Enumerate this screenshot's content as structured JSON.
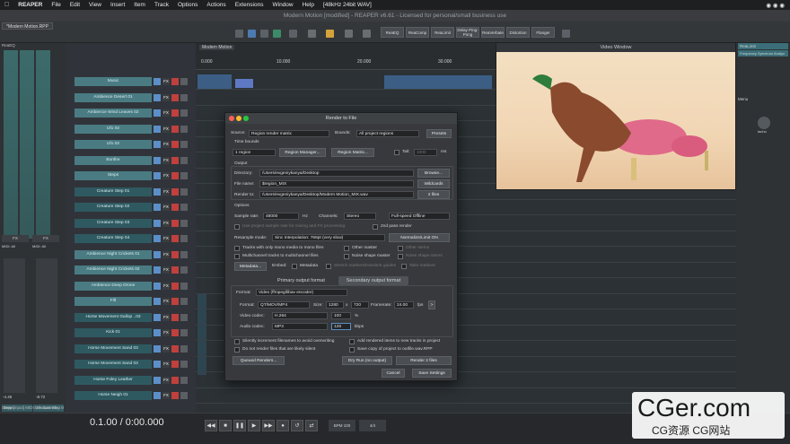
{
  "menubar": {
    "app": "REAPER",
    "items": [
      "File",
      "Edit",
      "View",
      "Insert",
      "Item",
      "Track",
      "Options",
      "Actions",
      "Extensions",
      "Window",
      "Help",
      "[48kHz 24bit WAV]"
    ]
  },
  "titlebar": {
    "title": "Modern Motion [modified] - REAPER v6.61 - Licensed for personal/small business use"
  },
  "toolbar": {
    "buttons": [
      "ReaEQ",
      "ReaComp",
      "ReaLimit",
      "Delay Ping-Pong",
      "ReaVerbate",
      "Distortion",
      "Flanger"
    ]
  },
  "tab": {
    "label": "*Modern Motion.RPP"
  },
  "project_tab": {
    "label": "Modern Motion"
  },
  "left": {
    "meter_label": "ReaEQ",
    "ticks": [
      "-4.45",
      "-8.72"
    ],
    "master": "MASTER",
    "track_name": "Steps",
    "track2_name": "Creature Step 01",
    "fx": [
      "FX",
      "FX"
    ],
    "midi": [
      "MIDI: All",
      "MIDI: All"
    ]
  },
  "tracks": [
    {
      "name": "Music",
      "dark": false
    },
    {
      "name": "Ambience Desert 01",
      "dark": false
    },
    {
      "name": "Ambience Wind Leaves 02",
      "dark": false
    },
    {
      "name": "Ufo 02",
      "dark": false
    },
    {
      "name": "Ufo 02",
      "dark": false
    },
    {
      "name": "Bonfire",
      "dark": false
    },
    {
      "name": "Steps",
      "dark": false
    },
    {
      "name": "Creature Step 01",
      "dark": true
    },
    {
      "name": "Creature Step 02",
      "dark": true
    },
    {
      "name": "Creature Step 03",
      "dark": true
    },
    {
      "name": "Creature Step 04",
      "dark": true
    },
    {
      "name": "Ambience Night Crickets 01",
      "dark": false
    },
    {
      "name": "Ambience Night Crickets 02",
      "dark": false
    },
    {
      "name": "Ambience Deep Drone",
      "dark": false
    },
    {
      "name": "Fill",
      "dark": false
    },
    {
      "name": "Horse Movement Gallop ..03",
      "dark": true
    },
    {
      "name": "Kick 01",
      "dark": true
    },
    {
      "name": "Horse Movement Sand 03",
      "dark": true
    },
    {
      "name": "Horse Movement Sand 03",
      "dark": true
    },
    {
      "name": "Horse Foley Leather",
      "dark": true
    },
    {
      "name": "Horse Neigh 01",
      "dark": true
    }
  ],
  "ruler": {
    "marks": [
      "0.000",
      "10.000",
      "20.000",
      "30.000"
    ]
  },
  "right": {
    "labels": [
      "ReaLimit",
      "Frequency Spectrum Analyz",
      "Menu",
      "tacho"
    ]
  },
  "transport": {
    "status": "Steps [input] MIDI: All channels",
    "time": "0.1.00 / 0:00.000",
    "bpm_label": "BPM",
    "bpm": "100",
    "sig": "4/4"
  },
  "dialog": {
    "title": "Render to File",
    "source_label": "Source:",
    "source": "Region render matrix",
    "bounds_label": "Bounds:",
    "bounds": "All project regions",
    "presets": "Presets",
    "time_bounds": "Time bounds",
    "regions": "1 region",
    "region_manager": "Region Manager...",
    "region_matrix": "Region Matrix...",
    "tail_label": "Tail:",
    "tail": "1000",
    "tail_unit": "ms",
    "output": "Output",
    "directory_label": "Directory:",
    "directory": "/Users/evgeniykanya/Desktop",
    "browse": "Browse...",
    "filename_label": "File name:",
    "filename": "$region_MIX",
    "wildcards": "Wildcards",
    "renderto_label": "Render to:",
    "renderto": "/Users/evgeniykanya/Desktop/Modern Motion_MIX.wav",
    "files": "2 files",
    "options": "Options",
    "samplerate_label": "Sample rate:",
    "samplerate": "48000",
    "hz": "Hz",
    "channels_label": "Channels:",
    "channels": "Stereo",
    "speed": "Full-speed Offline",
    "use_project": "Use project sample rate for mixing and FX processing",
    "second_pass": "2nd pass render",
    "resample_label": "Resample mode:",
    "resample": "Sinc Interpolation: 768pt (very slow)",
    "normalize": "Normalize/Limit ON",
    "chk_mono": "Tracks with only mono media to mono files",
    "chk_multi": "Multichannel tracks to multichannel files",
    "chk_other_master": "Other master",
    "chk_noise_master": "Noise shape master",
    "chk_other_stems": "Other stems",
    "chk_noise_stems": "Noise shape stems",
    "metadata_btn": "Metadata...",
    "embed": "Embed:",
    "chk_metadata": "Metadata",
    "chk_stretch": "Stretch markers/transient guides",
    "chk_take": "Take markers",
    "tab_primary": "Primary output format",
    "tab_secondary": "Secondary output format",
    "format_label": "Format:",
    "format": "Video (ffmpeg/libav encoder)",
    "format2_label": "Format:",
    "format2": "QT/MOV/MP4",
    "size_label": "Size:",
    "width": "1280",
    "x": "x",
    "height": "720",
    "framerate_label": "Framerate:",
    "framerate": "24.00",
    "fps": "fps",
    "videocodec_label": "Video codec:",
    "videocodec": "H.264",
    "vquality": "100",
    "pct": "%",
    "audiocodec_label": "Audio codec:",
    "audiocodec": "MP3",
    "abitrate": "128",
    "kbps": "kbps",
    "chk_silent": "Silently increment filenames to avoid overwriting",
    "chk_dontrender": "Do not render files that are likely silent",
    "chk_addrendered": "Add rendered items to new tracks in project",
    "chk_savecopy": "Save copy of project to outfile.wav.RPP",
    "queued": "Queued Renders...",
    "dryrun": "Dry Run (no output)",
    "render": "Render 2 files",
    "cancel": "Cancel",
    "save": "Save Settings"
  },
  "video_window": {
    "title": "Video Window"
  },
  "watermark": {
    "brand": "CGer.com",
    "sub": "CG资源  CG网站"
  }
}
